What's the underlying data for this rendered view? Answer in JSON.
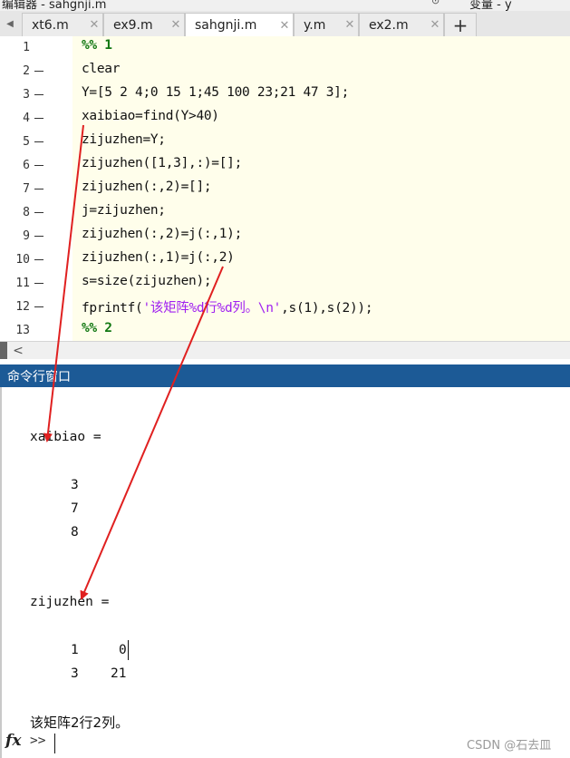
{
  "window": {
    "title": "编辑器 - sahgnji.m",
    "variables_panel": "变量 - y"
  },
  "tabs": [
    {
      "label": "xt6.m",
      "active": false
    },
    {
      "label": "ex9.m",
      "active": false
    },
    {
      "label": "sahgnji.m",
      "active": true
    },
    {
      "label": "y.m",
      "active": false
    },
    {
      "label": "ex2.m",
      "active": false
    }
  ],
  "tab_close_glyph": "✕",
  "add_tab_glyph": "+",
  "editor": {
    "lines": [
      {
        "num": "1",
        "text": "%% 1",
        "kind": "cell"
      },
      {
        "num": "2",
        "text": "clear",
        "kind": "code"
      },
      {
        "num": "3",
        "text": "Y=[5 2 4;0 15 1;45 100 23;21 47 3];",
        "kind": "code"
      },
      {
        "num": "4",
        "text": "xaibiao=find(Y>40)",
        "kind": "code"
      },
      {
        "num": "5",
        "text": "zijuzhen=Y;",
        "kind": "code"
      },
      {
        "num": "6",
        "text": "zijuzhen([1,3],:)=[];",
        "kind": "code"
      },
      {
        "num": "7",
        "text": "zijuzhen(:,2)=[];",
        "kind": "code"
      },
      {
        "num": "8",
        "text": "j=zijuzhen;",
        "kind": "code"
      },
      {
        "num": "9",
        "text": "zijuzhen(:,2)=j(:,1);",
        "kind": "code"
      },
      {
        "num": "10",
        "text": "zijuzhen(:,1)=j(:,2)",
        "kind": "code"
      },
      {
        "num": "11",
        "text": "s=size(zijuzhen);",
        "kind": "code"
      },
      {
        "num": "12",
        "text": "fprintf('该矩阵%d行%d列。\\n',s(1),s(2));",
        "kind": "fprintf"
      },
      {
        "num": "13",
        "text": "%% 2",
        "kind": "cell"
      }
    ]
  },
  "command_window": {
    "title": "命令行窗口",
    "xaibiao_label": "xaibiao =",
    "xaibiao_values": [
      "3",
      "7",
      "8"
    ],
    "zijuzhen_label": "zijuzhen =",
    "zijuzhen_rows": [
      [
        "1",
        "0"
      ],
      [
        "3",
        "21"
      ]
    ],
    "message": "该矩阵2行2列。",
    "prompt": ">>"
  },
  "watermark": "CSDN @石去皿",
  "colors": {
    "cell_marker": "#117711",
    "string": "#a020f0",
    "command_header": "#1c5a96",
    "code_background": "#fffeeb",
    "arrow": "#e02020"
  }
}
